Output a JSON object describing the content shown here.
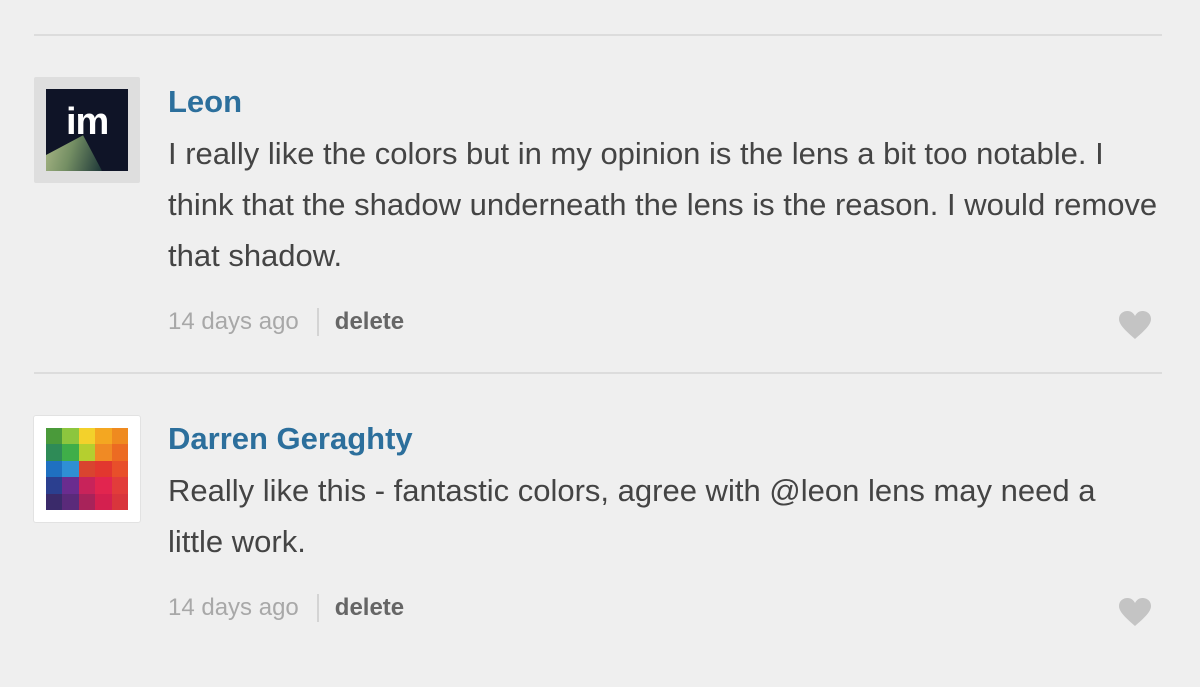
{
  "comments": [
    {
      "author": "Leon",
      "avatar": "im-logo",
      "avatar_text": "im",
      "text": "I really like the colors but in my opinion is the lens a bit too notable. I think that the shadow underneath the lens is the reason. I would remove that shadow.",
      "time": "14 days ago",
      "action": "delete",
      "like_icon": "heart-icon"
    },
    {
      "author": "Darren Geraghty",
      "avatar": "color-grid",
      "text": "Really like this - fantastic colors, agree with @leon lens may need a little work.",
      "time": "14 days ago",
      "action": "delete",
      "like_icon": "heart-icon"
    }
  ],
  "colors": {
    "background": "#efefef",
    "author": "#2c6f9c",
    "text": "#444444",
    "meta": "#a8a8a8",
    "action": "#666666",
    "heart": "#c4c4c4"
  },
  "avatar_grid_colors": [
    "#4a9a3a",
    "#8cc63e",
    "#f3d12b",
    "#f4a721",
    "#ef8a1f",
    "#2e8b57",
    "#3fae49",
    "#b5cf2f",
    "#f08a24",
    "#ec6b22",
    "#1f70c1",
    "#2f8fd4",
    "#d9442f",
    "#e2372f",
    "#e84f2a",
    "#2b3f8f",
    "#6a2c8f",
    "#c8235a",
    "#e2254f",
    "#e23c3a",
    "#3a2a6a",
    "#5a2a7a",
    "#a8235a",
    "#d4204f",
    "#d9353c"
  ]
}
